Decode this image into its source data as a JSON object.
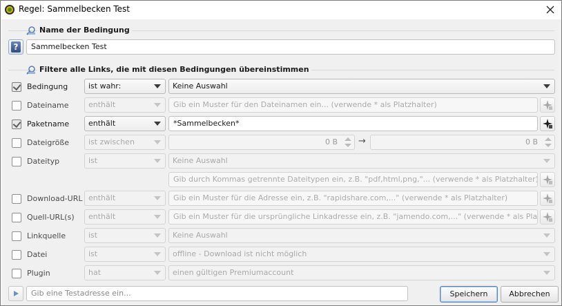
{
  "window": {
    "title": "Regel: Sammelbecken Test"
  },
  "section_name": {
    "title": "Name der Bedingung",
    "value": "Sammelbecken Test"
  },
  "section_filter": {
    "title": "Filtere alle Links, die mit diesen Bedingungen übereinstimmen"
  },
  "rows": {
    "bedingung": {
      "label": "Bedingung",
      "checked": true,
      "op": "ist wahr:",
      "value": "Keine Auswahl"
    },
    "dateiname": {
      "label": "Dateiname",
      "checked": false,
      "op": "enthält",
      "placeholder": "Gib ein Muster für den Dateinamen ein... (verwende * als Platzhalter)"
    },
    "paketname": {
      "label": "Paketname",
      "checked": true,
      "op": "enthält",
      "value": "*Sammelbecken*"
    },
    "dateigroesse": {
      "label": "Dateigröße",
      "checked": false,
      "op": "ist zwischen",
      "min": "0 B",
      "max": "0 B"
    },
    "dateityp": {
      "label": "Dateityp",
      "checked": false,
      "op": "ist",
      "value": "Keine Auswahl",
      "placeholder": "Gib durch Kommas getrennte Dateitypen ein, z.B. \"pdf,html,png,\"... (verwende * als Platzhalter)"
    },
    "download_url": {
      "label": "Download-URL",
      "checked": false,
      "op": "enthält",
      "placeholder": "Gib ein Muster für die Adresse ein, z.B. \"rapidshare.com,...\" (verwende * als Platzhalter)"
    },
    "quell_url": {
      "label": "Quell-URL(s)",
      "checked": false,
      "op": "enthält",
      "placeholder": "Gib ein Muster für die ursprüngliche Linkadresse ein, z.B. \"jamendo.com,...\" (verwende * als Platzhalter)"
    },
    "linkquelle": {
      "label": "Linkquelle",
      "checked": false,
      "op": "ist",
      "value": "Keine Auswahl"
    },
    "datei": {
      "label": "Datei",
      "checked": false,
      "op": "ist",
      "value": "offline - Download ist nicht möglich"
    },
    "plugin": {
      "label": "Plugin",
      "checked": false,
      "op": "hat",
      "value": "einen gültigen Premiumaccount"
    }
  },
  "bottom": {
    "test_placeholder": "Gib eine Testadresse ein...",
    "save_label": "Speichern",
    "cancel_label": "Abbrechen"
  },
  "colors": {
    "accent": "#5b84be",
    "background": "#f0f0f0"
  },
  "icons": [
    "app-icon",
    "close-icon",
    "filter-icon",
    "help-icon",
    "pattern-icon",
    "arrow-right-icon",
    "play-icon",
    "chevron-down-icon"
  ]
}
